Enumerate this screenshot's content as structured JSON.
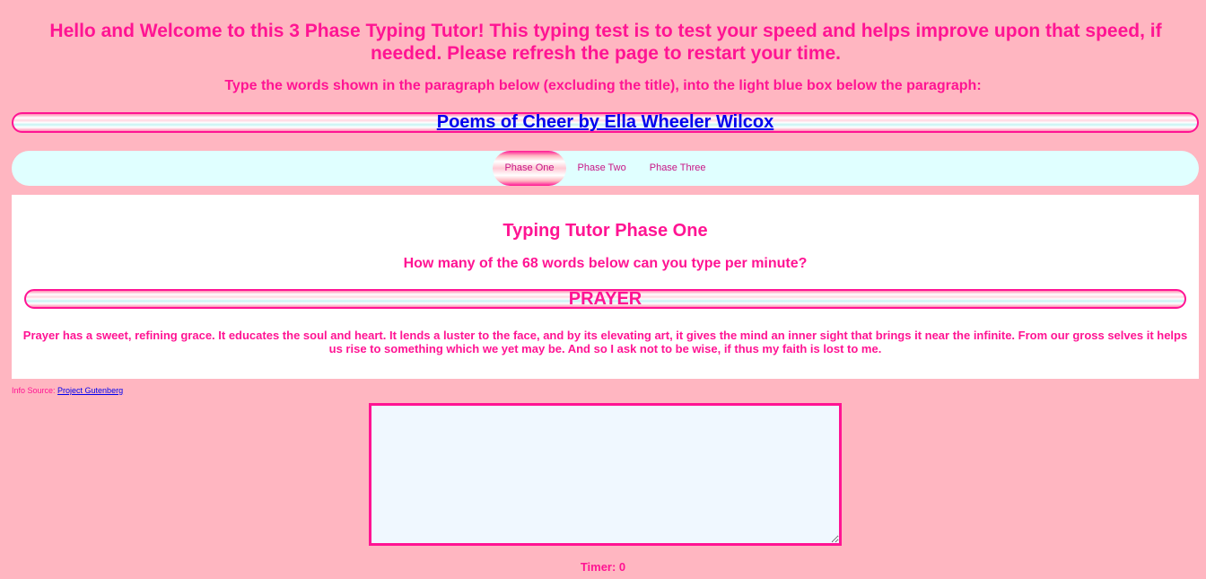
{
  "header": {
    "welcome": "Hello and Welcome to this 3 Phase Typing Tutor! This typing test is to test your speed and helps improve upon that speed, if needed. Please refresh the page to restart your time.",
    "instructions": "Type the words shown in the paragraph below (excluding the title), into the light blue box below the paragraph:"
  },
  "book": {
    "title_link": "Poems of Cheer by Ella Wheeler Wilcox"
  },
  "nav": {
    "tabs": [
      {
        "label": "Phase One",
        "active": true
      },
      {
        "label": "Phase Two",
        "active": false
      },
      {
        "label": "Phase Three",
        "active": false
      }
    ]
  },
  "panel": {
    "title": "Typing Tutor Phase One",
    "question": "How many of the 68 words below can you type per minute?",
    "poem_title": "PRAYER",
    "poem_text": "Prayer has a sweet, refining grace. It educates the soul and heart. It lends a luster to the face, and by its elevating art, it gives the mind an inner sight that brings it near the infinite. From our gross selves it helps us rise to something which we yet may be. And so I ask not to be wise, if thus my faith is lost to me."
  },
  "source": {
    "label": "Info Source: ",
    "link": "Project Gutenberg"
  },
  "typing_input": {
    "value": ""
  },
  "timer": {
    "text": "Timer: 0"
  },
  "colors": {
    "background": "#ffb6c1",
    "text": "#ff1493",
    "nav_background": "#e0ffff",
    "input_background": "#f0f8ff",
    "link": "#0000ee"
  }
}
